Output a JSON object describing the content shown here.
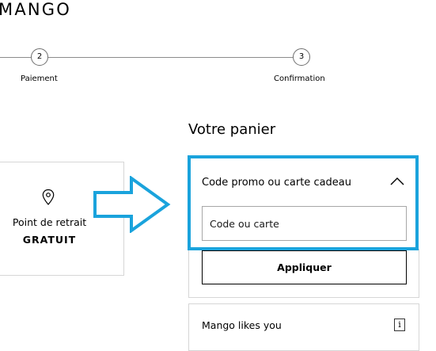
{
  "brand": {
    "logo_text": "MANGO"
  },
  "checkout_steps": [
    {
      "number": "2",
      "label": "Paiement"
    },
    {
      "number": "3",
      "label": "Confirmation"
    }
  ],
  "cart": {
    "title": "Votre panier"
  },
  "delivery": {
    "icon": "location-pin-icon",
    "label": "Point de retrait",
    "price": "GRATUIT"
  },
  "annotation": {
    "arrow_color": "#1aa3dc",
    "highlight_color": "#1aa3dc"
  },
  "promo": {
    "title": "Code promo ou carte cadeau",
    "toggle_icon": "chevron-up-icon",
    "input_value": "",
    "input_placeholder": "Code ou carte",
    "apply_label": "Appliquer"
  },
  "loyalty": {
    "label": "Mango likes you",
    "info_icon": "info-icon",
    "info_glyph": "i"
  }
}
